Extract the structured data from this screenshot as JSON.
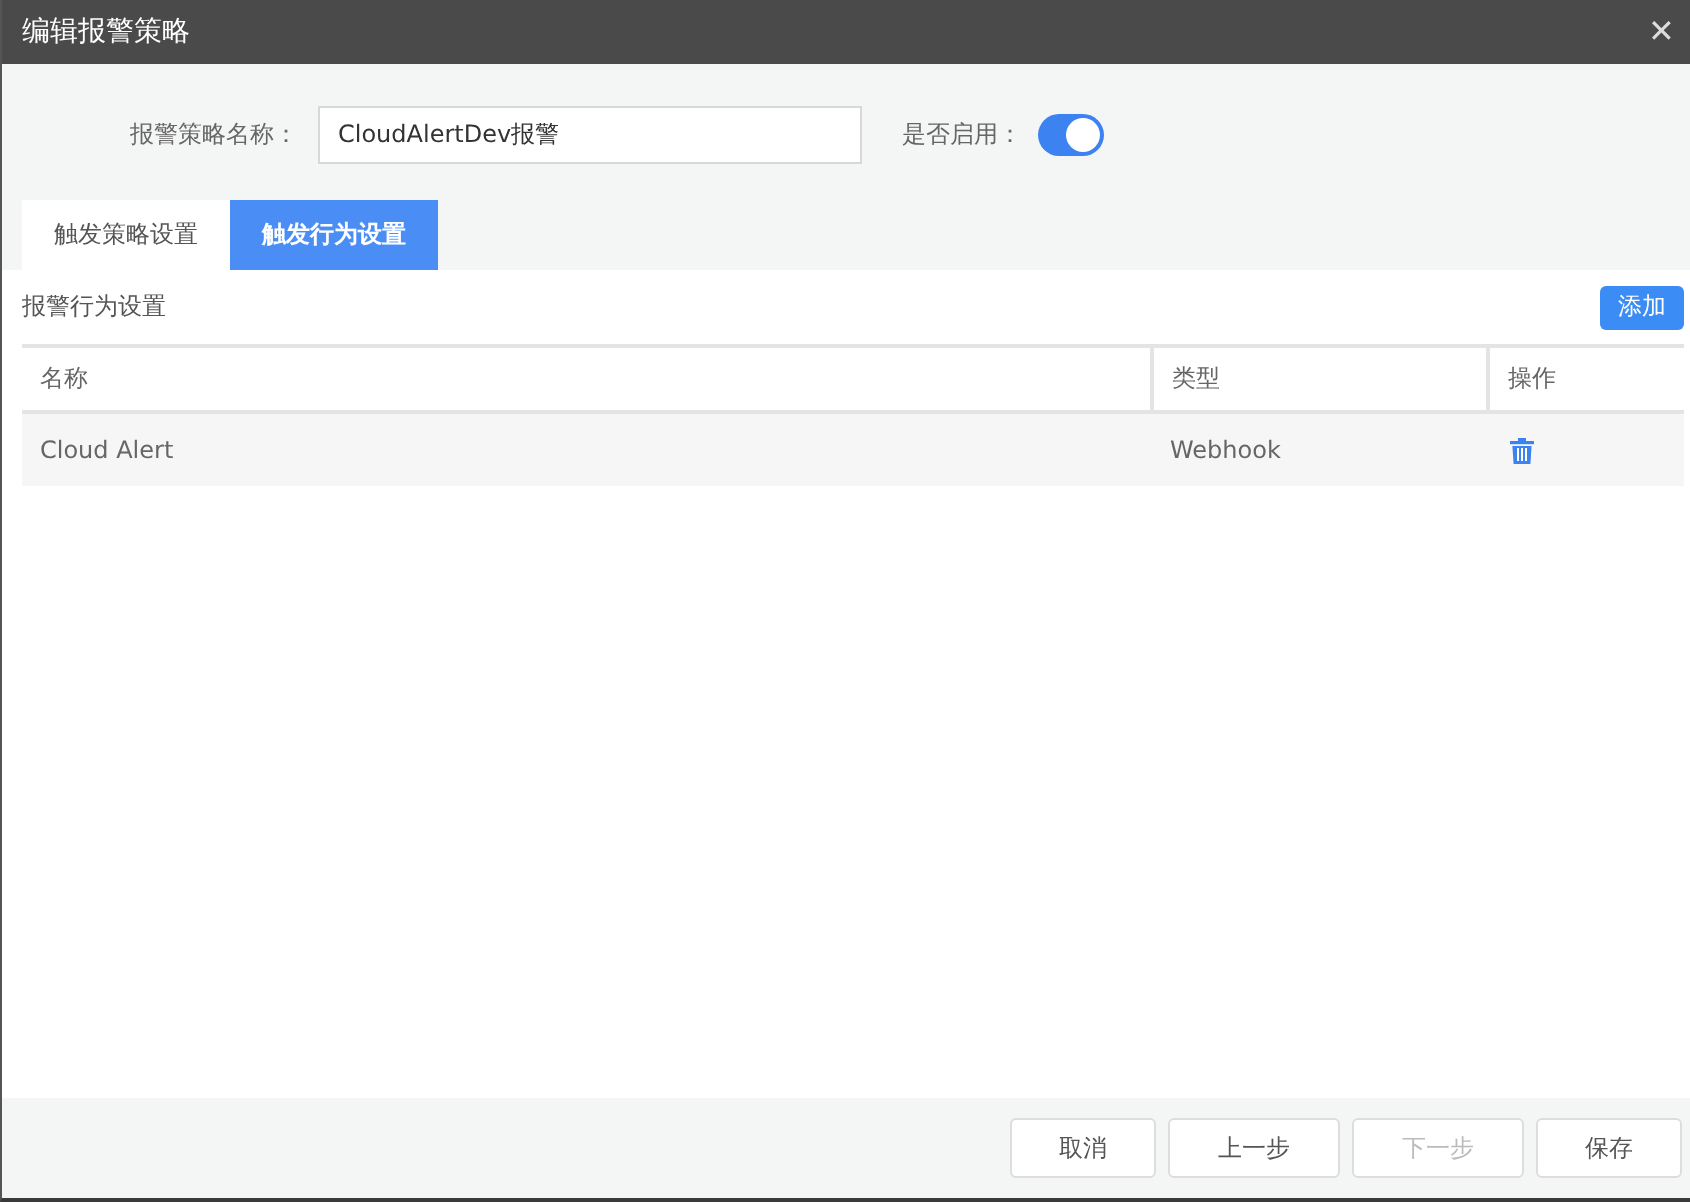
{
  "window": {
    "title": "编辑报警策略",
    "close": "✕"
  },
  "form": {
    "name_label": "报警策略名称：",
    "name_value": "CloudAlertDev报警",
    "enable_label": "是否启用：",
    "enabled": true
  },
  "tabs": [
    {
      "label": "触发策略设置",
      "selected": false
    },
    {
      "label": "触发行为设置",
      "selected": true
    }
  ],
  "section": {
    "title": "报警行为设置",
    "add_button": "添加"
  },
  "table": {
    "columns": [
      "名称",
      "类型",
      "操作"
    ],
    "rows": [
      {
        "name": "Cloud Alert",
        "type": "Webhook"
      }
    ]
  },
  "buttons": [
    {
      "label": "取消",
      "disabled": false
    },
    {
      "label": "上一步",
      "disabled": false
    },
    {
      "label": "下一步",
      "disabled": true
    },
    {
      "label": "保存",
      "disabled": false
    }
  ]
}
